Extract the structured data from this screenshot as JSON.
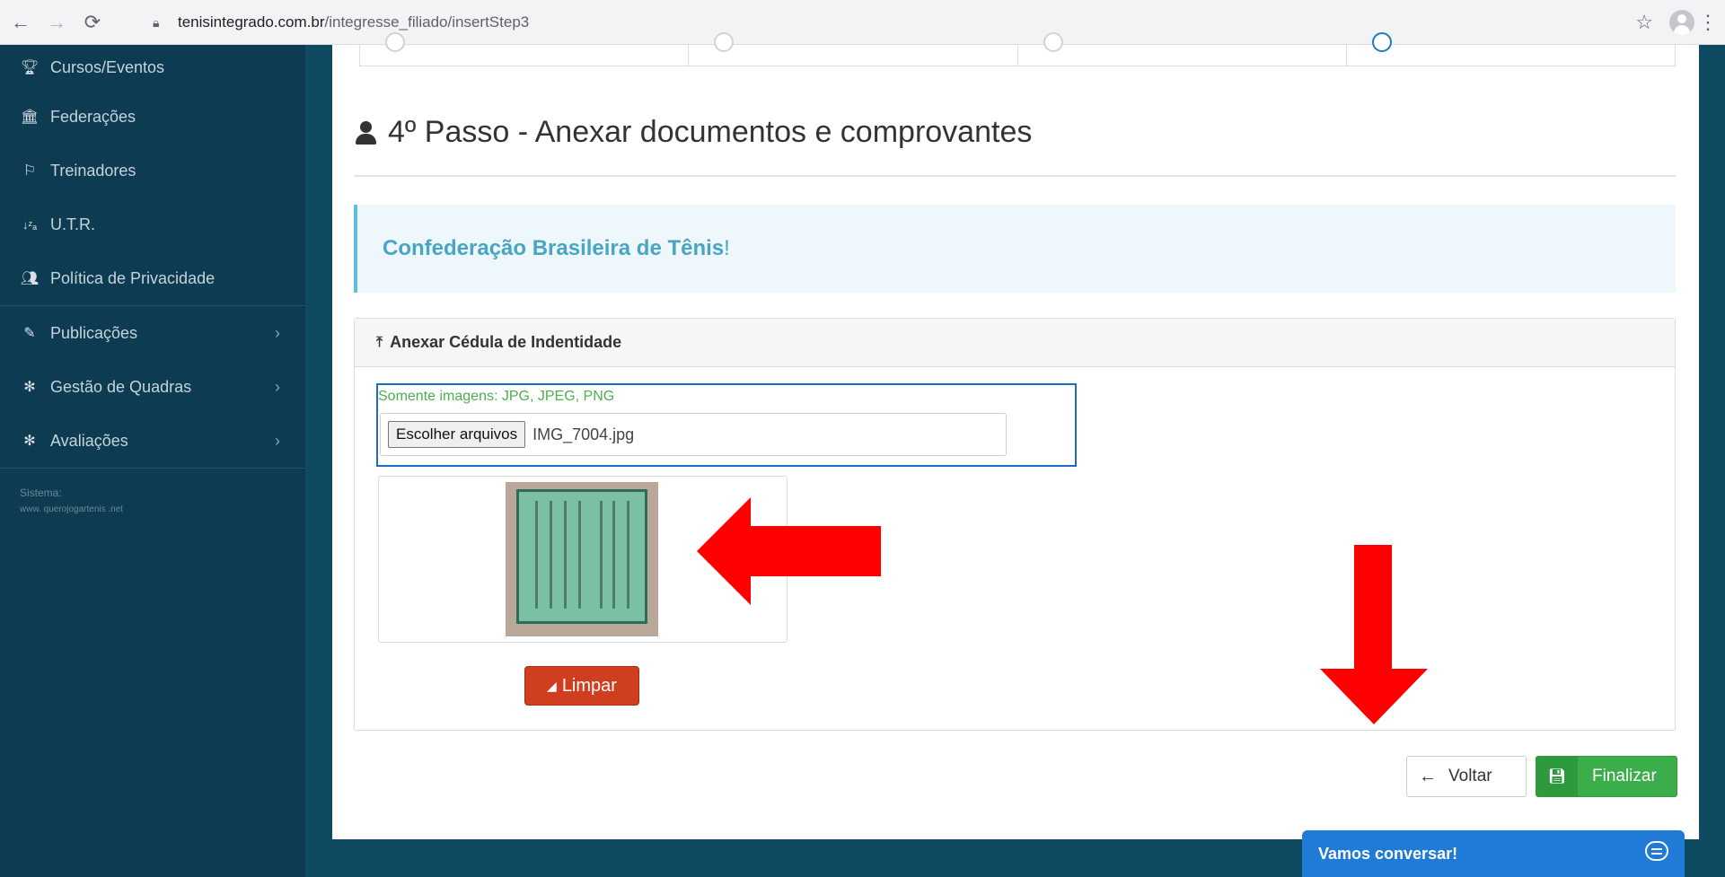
{
  "browser": {
    "url_host": "tenisintegrado.com.br",
    "url_path": "/integresse_filiado/insertStep3"
  },
  "sidebar": {
    "items": [
      {
        "label": "Cursos/Eventos",
        "icon": "trophy-icon"
      },
      {
        "label": "Federações",
        "icon": "institution-icon"
      },
      {
        "label": "Treinadores",
        "icon": "flag-icon"
      },
      {
        "label": "U.T.R.",
        "icon": "sort-az-icon"
      },
      {
        "label": "Política de Privacidade",
        "icon": "users-icon"
      },
      {
        "label": "Publicações",
        "icon": "edit-icon",
        "chevron": "›"
      },
      {
        "label": "Gestão de Quadras",
        "icon": "cog-icon",
        "chevron": "›"
      },
      {
        "label": "Avaliações",
        "icon": "cog-icon",
        "chevron": "›"
      }
    ],
    "system_label": "Sistema:",
    "logo_text": "www. querojogartenis .net"
  },
  "main": {
    "heading": "4º Passo - Anexar documentos e comprovantes",
    "callout_text": "Confederação Brasileira de Tênis",
    "callout_excl": "!",
    "panel_title": "Anexar Cédula de Indentidade",
    "upload_hint": "Somente imagens: JPG, JPEG, PNG",
    "file_button": "Escolher arquivos",
    "file_name": "IMG_7004.jpg",
    "clear_button": "Limpar",
    "back_button": "Voltar",
    "finish_button": "Finalizar"
  },
  "chat": {
    "label": "Vamos conversar!"
  },
  "colors": {
    "sidebar": "#0d3b52",
    "accent_green": "#3bad4a",
    "clear_red": "#cf3e1f",
    "callout_text": "#49a5c4",
    "chat_blue": "#1f7bd6",
    "arrow_red": "#ff0000"
  }
}
